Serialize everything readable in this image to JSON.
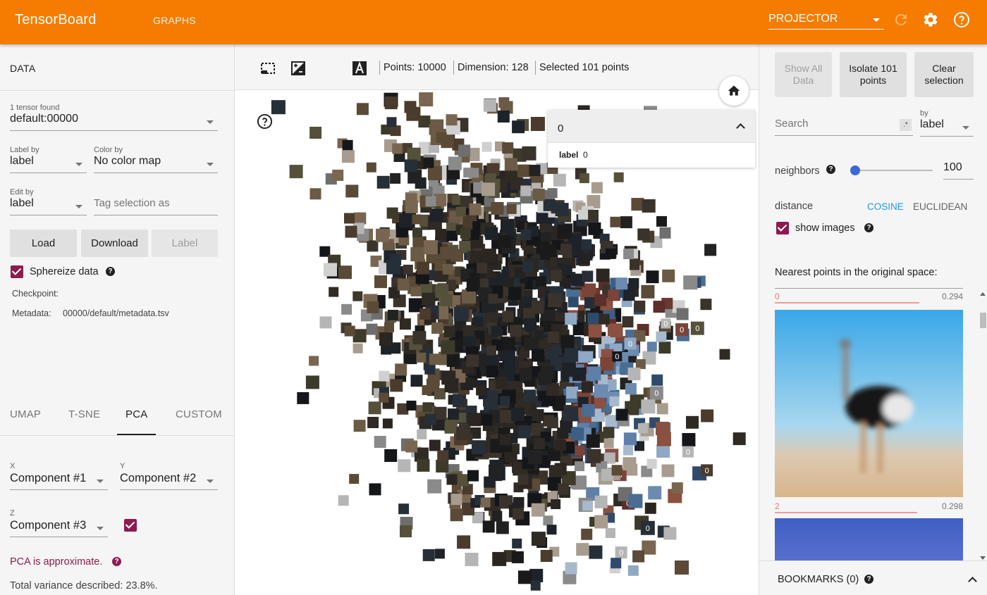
{
  "header": {
    "brand": "TensorBoard",
    "tab_graphs": "GRAPHS",
    "plugin_selected": "PROJECTOR"
  },
  "left": {
    "section_title": "DATA",
    "tensor_found_label": "1 tensor found",
    "tensor_value": "default:00000",
    "label_by_label": "Label by",
    "label_by_value": "label",
    "color_by_label": "Color by",
    "color_by_value": "No color map",
    "edit_by_label": "Edit by",
    "edit_by_value": "label",
    "tag_placeholder": "Tag selection as",
    "load": "Load",
    "download": "Download",
    "label_btn": "Label",
    "sphereize": "Sphereize data",
    "checkpoint_label": "Checkpoint:",
    "metadata_label": "Metadata:",
    "metadata_value": "00000/default/metadata.tsv",
    "tabs": [
      "UMAP",
      "T-SNE",
      "PCA",
      "CUSTOM"
    ],
    "x_label": "X",
    "x_value": "Component #1",
    "y_label": "Y",
    "y_value": "Component #2",
    "z_label": "Z",
    "z_value": "Component #3",
    "pca_note": "PCA is approximate.",
    "variance": "Total variance described: 23.8%."
  },
  "center": {
    "points": "Points: 10000",
    "dimension": "Dimension: 128",
    "selected": "Selected 101 points",
    "search_value": "0",
    "result_key": "label",
    "result_value": "0"
  },
  "right": {
    "show_all": "Show All Data",
    "isolate": "Isolate 101 points",
    "clear": "Clear selection",
    "search_placeholder": "Search",
    "regex_icon": ".*",
    "by_label": "by",
    "by_value": "label",
    "neighbors_label": "neighbors",
    "neighbors_value": "100",
    "neighbors_fraction": 0.02,
    "distance_label": "distance",
    "cosine": "COSINE",
    "euclidean": "EUCLIDEAN",
    "show_images": "show images",
    "nearest_title": "Nearest points in the original space:",
    "nearest": [
      {
        "name": "0",
        "dist": "0.294"
      },
      {
        "name": "2",
        "dist": "0.298"
      }
    ],
    "bookmarks": "BOOKMARKS (0)"
  },
  "colors": {
    "header": "#f57c00",
    "accent": "#8e1b4e",
    "link": "#2196f3",
    "slider": "#3b6ad6"
  },
  "icons": [
    "refresh-icon",
    "settings-icon",
    "help-icon",
    "select-rect-icon",
    "night-mode-icon",
    "label-toggle-icon",
    "brightness-icon",
    "home-icon",
    "chevron-up-icon"
  ]
}
